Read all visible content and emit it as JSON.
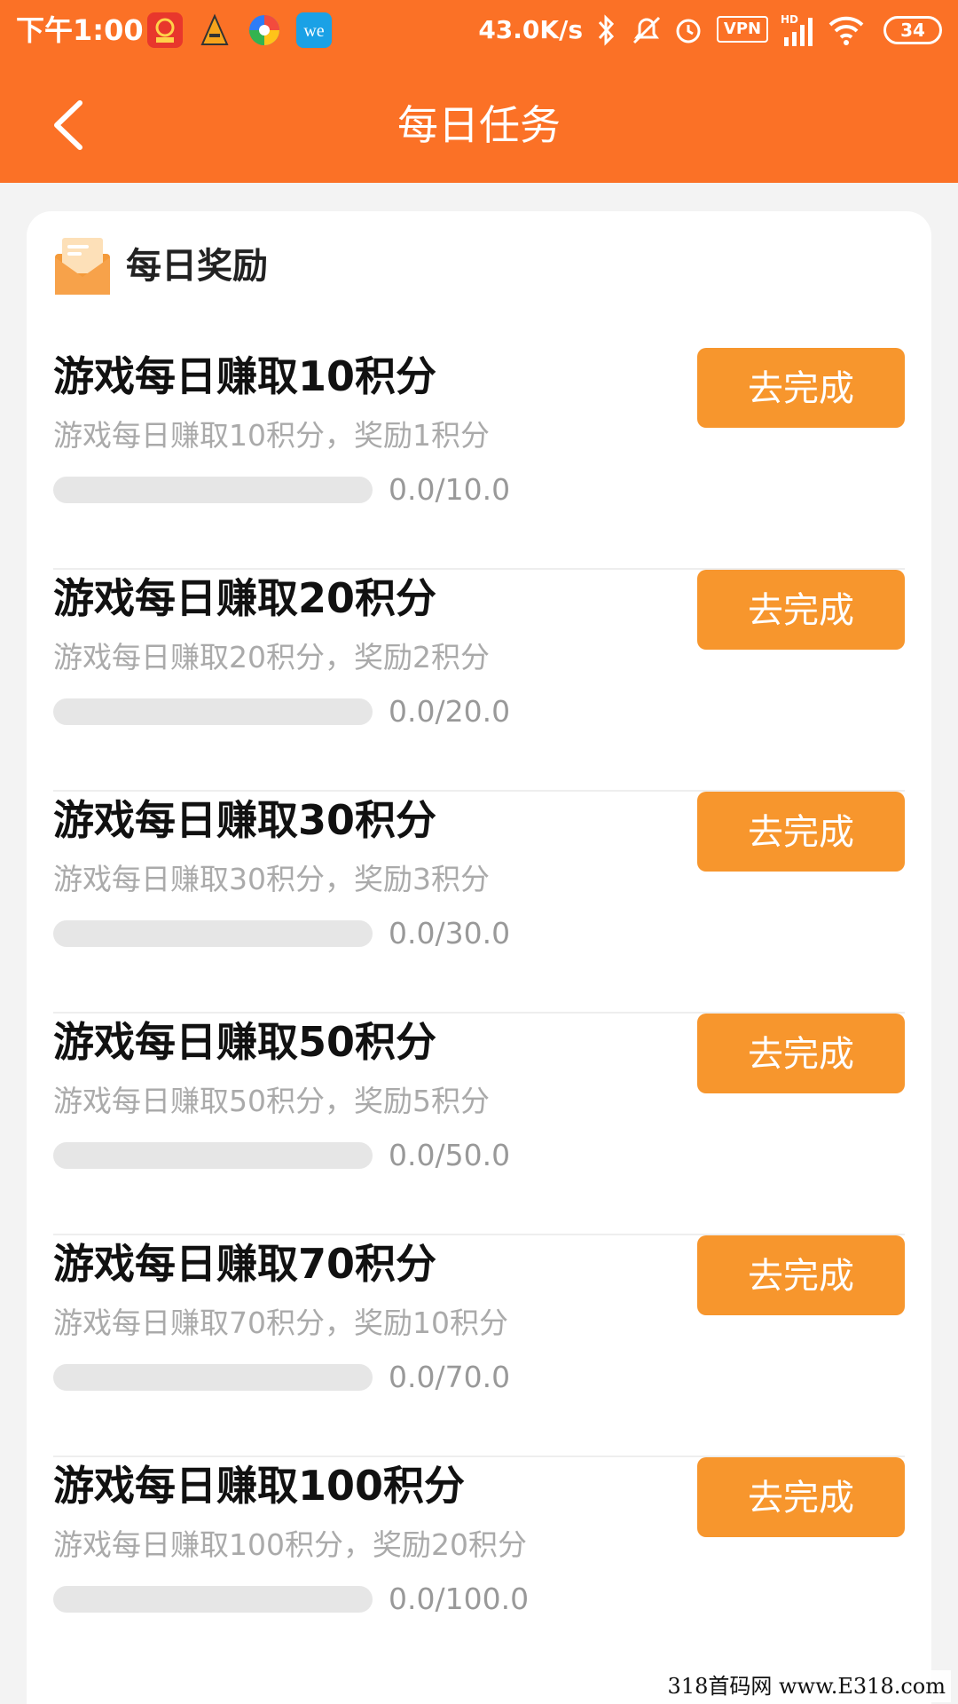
{
  "status_bar": {
    "time": "下午1:00",
    "network_speed": "43.0K/s",
    "battery": "34",
    "vpn_label": "VPN",
    "hd_label": "HD",
    "app_icons": [
      "taobao-app-icon",
      "a-app-icon",
      "browser-app-icon",
      "we-app-icon"
    ],
    "status_icons": [
      "bluetooth-icon",
      "mute-icon",
      "alarm-icon",
      "vpn-icon",
      "signal-icon",
      "wifi-icon",
      "battery-icon"
    ]
  },
  "nav": {
    "title": "每日任务",
    "back_icon": "chevron-left-icon"
  },
  "card": {
    "title": "每日奖励",
    "icon": "envelope-icon"
  },
  "tasks": [
    {
      "title": "游戏每日赚取10积分",
      "desc": "游戏每日赚取10积分，奖励1积分",
      "progress_text": "0.0/10.0",
      "progress": 0,
      "button": "去完成"
    },
    {
      "title": "游戏每日赚取20积分",
      "desc": "游戏每日赚取20积分，奖励2积分",
      "progress_text": "0.0/20.0",
      "progress": 0,
      "button": "去完成"
    },
    {
      "title": "游戏每日赚取30积分",
      "desc": "游戏每日赚取30积分，奖励3积分",
      "progress_text": "0.0/30.0",
      "progress": 0,
      "button": "去完成"
    },
    {
      "title": "游戏每日赚取50积分",
      "desc": "游戏每日赚取50积分，奖励5积分",
      "progress_text": "0.0/50.0",
      "progress": 0,
      "button": "去完成"
    },
    {
      "title": "游戏每日赚取70积分",
      "desc": "游戏每日赚取70积分，奖励10积分",
      "progress_text": "0.0/70.0",
      "progress": 0,
      "button": "去完成"
    },
    {
      "title": "游戏每日赚取100积分",
      "desc": "游戏每日赚取100积分，奖励20积分",
      "progress_text": "0.0/100.0",
      "progress": 0,
      "button": "去完成"
    }
  ],
  "watermark": "318首码网 www.E318.com",
  "colors": {
    "header": "#fb7126",
    "accent": "#f7962d",
    "background": "#f3f3f3"
  }
}
